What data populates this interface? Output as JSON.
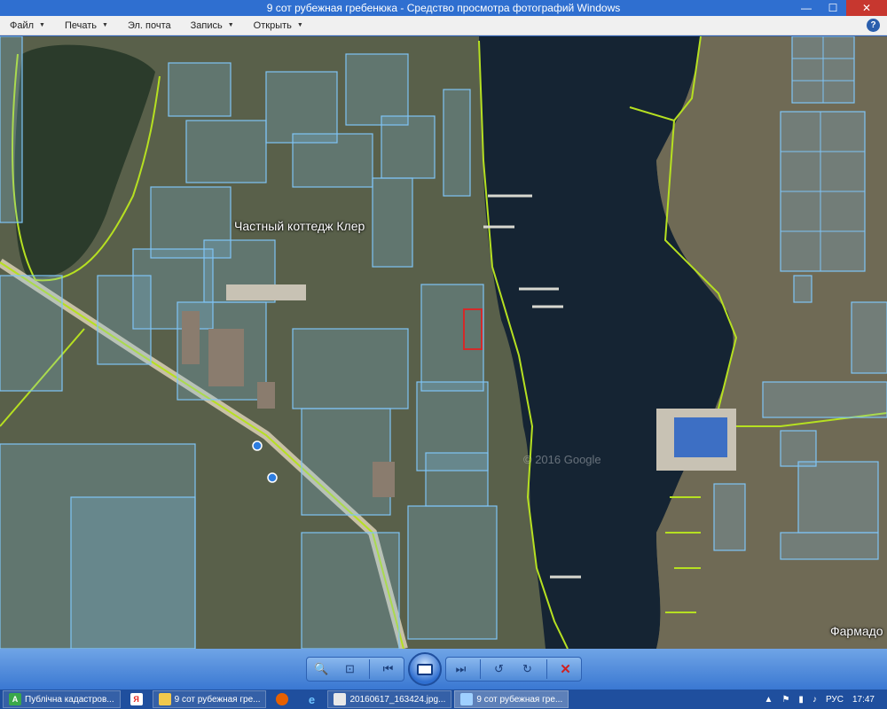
{
  "window": {
    "title": "9 сот  рубежная гребенюка - Средство просмотра фотографий Windows",
    "minimize_glyph": "—",
    "maximize_glyph": "☐",
    "close_glyph": "✕"
  },
  "menu": {
    "items": [
      {
        "label": "Файл",
        "has_dropdown": true
      },
      {
        "label": "Печать",
        "has_dropdown": true
      },
      {
        "label": "Эл. почта",
        "has_dropdown": false
      },
      {
        "label": "Запись",
        "has_dropdown": true
      },
      {
        "label": "Открыть",
        "has_dropdown": true
      }
    ],
    "help_glyph": "?"
  },
  "map": {
    "labels": {
      "cottage": "Частный коттедж Клер",
      "pharmacy": "Фармадо"
    },
    "watermark": "© 2016 Google",
    "colors": {
      "water": "#152433",
      "land": "#5a5f49",
      "parcel": "#7fc4f5",
      "boundary": "#b6e021",
      "highlight": "#d42a2a"
    }
  },
  "toolbar": {
    "icons": [
      "zoom-icon",
      "actual-size-icon",
      "previous-icon",
      "slideshow-icon",
      "next-icon",
      "rotate-left-icon",
      "rotate-right-icon",
      "delete-icon"
    ]
  },
  "taskbar": {
    "tasks": [
      {
        "label": "Публічна кадастров...",
        "icon": "browser-a-icon",
        "active": false
      },
      {
        "label": "9 сот рубежная гре...",
        "icon": "folder-icon",
        "active": false
      },
      {
        "label": "20160617_163424.jpg...",
        "icon": "photo-icon",
        "active": false
      },
      {
        "label": "9 сот  рубежная гре...",
        "icon": "photo-viewer-icon",
        "active": true
      }
    ],
    "pins": [
      "yandex-icon",
      "firefox-icon",
      "ie-icon"
    ],
    "tray": {
      "language": "РУС",
      "time": "17:47"
    }
  }
}
